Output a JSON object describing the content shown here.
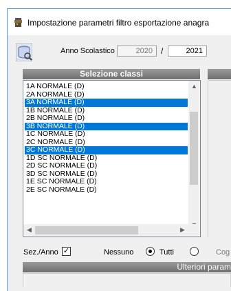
{
  "window": {
    "title": "Impostazione parametri filtro esportazione anagra"
  },
  "toolbar": {
    "year_label": "Anno Scolastico",
    "year_from": "2020",
    "year_sep": "/",
    "year_to": "2021"
  },
  "classes_panel": {
    "header": "Selezione classi",
    "items": [
      {
        "label": "1A NORMALE (D)",
        "selected": false
      },
      {
        "label": "2A NORMALE (D)",
        "selected": false
      },
      {
        "label": "3A NORMALE (D)",
        "selected": true
      },
      {
        "label": "1B NORMALE (D)",
        "selected": false
      },
      {
        "label": "2B NORMALE (D)",
        "selected": false
      },
      {
        "label": "3B NORMALE (D)",
        "selected": true
      },
      {
        "label": "1C NORMALE (D)",
        "selected": false
      },
      {
        "label": "2C NORMALE (D)",
        "selected": false
      },
      {
        "label": "3C NORMALE (D)",
        "selected": true
      },
      {
        "label": "1D SC NORMALE (D)",
        "selected": false
      },
      {
        "label": "2D SC NORMALE (D)",
        "selected": false
      },
      {
        "label": "3D SC NORMALE (D)",
        "selected": false
      },
      {
        "label": "1E SC NORMALE (D)",
        "selected": false
      },
      {
        "label": "2E SC NORMALE (D)",
        "selected": false
      }
    ],
    "sez_anno_label": "Sez./Anno",
    "sez_anno_checked": true,
    "nessuno_label": "Nessuno",
    "tutti_label": "Tutti",
    "selection_mode": "nessuno"
  },
  "right_panel": {
    "partial_label": "Cog"
  },
  "lower_section": {
    "header": "Ulteriori param"
  },
  "colors": {
    "selection": "#0078d7",
    "header_bar": "#808080",
    "window_bg": "#f0f0f0"
  }
}
